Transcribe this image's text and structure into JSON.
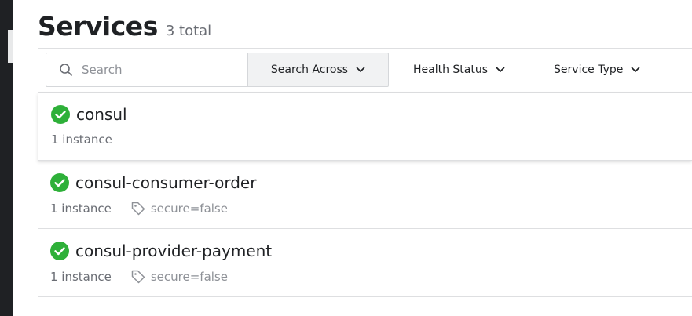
{
  "header": {
    "title": "Services",
    "count": "3 total"
  },
  "toolbar": {
    "search_placeholder": "Search",
    "search_across_label": "Search Across",
    "health_status_label": "Health Status",
    "service_type_label": "Service Type"
  },
  "services": [
    {
      "name": "consul",
      "instances": "1 instance",
      "tag": "",
      "status": "passing"
    },
    {
      "name": "consul-consumer-order",
      "instances": "1 instance",
      "tag": "secure=false",
      "status": "passing"
    },
    {
      "name": "consul-provider-payment",
      "instances": "1 instance",
      "tag": "secure=false",
      "status": "passing"
    }
  ],
  "colors": {
    "passing": "#2eb039",
    "sidebar": "#1f2124"
  },
  "icons": {
    "search": "search-icon",
    "chevron": "chevron-down-icon",
    "health": "check-circle-icon",
    "tag": "tag-icon"
  }
}
